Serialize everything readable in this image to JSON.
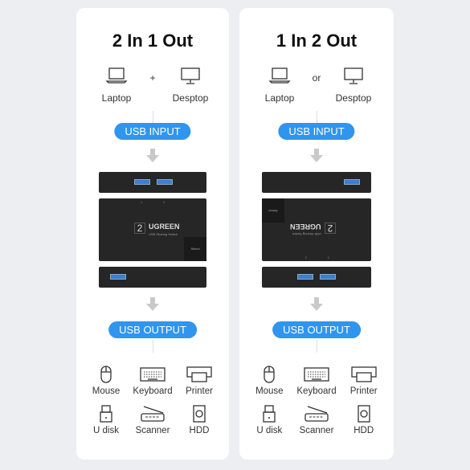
{
  "panels": [
    {
      "title": "2 In 1 Out",
      "sources": [
        {
          "label": "Laptop",
          "icon": "laptop-icon"
        },
        {
          "label": "Desptop",
          "icon": "desktop-icon"
        }
      ],
      "separator": "+",
      "input_label": "USB INPUT",
      "output_label": "USB OUTPUT",
      "device": {
        "brand": "UGREEN",
        "subtitle": "USB Sharing Switch",
        "number": "2",
        "select": "Select",
        "port_labels": [
          "1",
          "2"
        ]
      }
    },
    {
      "title": "1 In 2 Out",
      "sources": [
        {
          "label": "Laptop",
          "icon": "laptop-icon"
        },
        {
          "label": "Desptop",
          "icon": "desktop-icon"
        }
      ],
      "separator": "or",
      "input_label": "USB INPUT",
      "output_label": "USB OUTPUT",
      "device": {
        "brand": "UGREEN",
        "subtitle": "USB Sharing Switch",
        "number": "2",
        "select": "Select",
        "port_labels": [
          "1",
          "2"
        ]
      }
    }
  ],
  "peripherals": [
    {
      "label": "Mouse",
      "icon": "mouse-icon"
    },
    {
      "label": "Keyboard",
      "icon": "keyboard-icon"
    },
    {
      "label": "Printer",
      "icon": "printer-icon"
    },
    {
      "label": "U disk",
      "icon": "usb-drive-icon"
    },
    {
      "label": "Scanner",
      "icon": "scanner-icon"
    },
    {
      "label": "HDD",
      "icon": "hdd-icon"
    }
  ],
  "colors": {
    "accent": "#2f95ee",
    "device": "#262626",
    "background": "#eceef1"
  }
}
